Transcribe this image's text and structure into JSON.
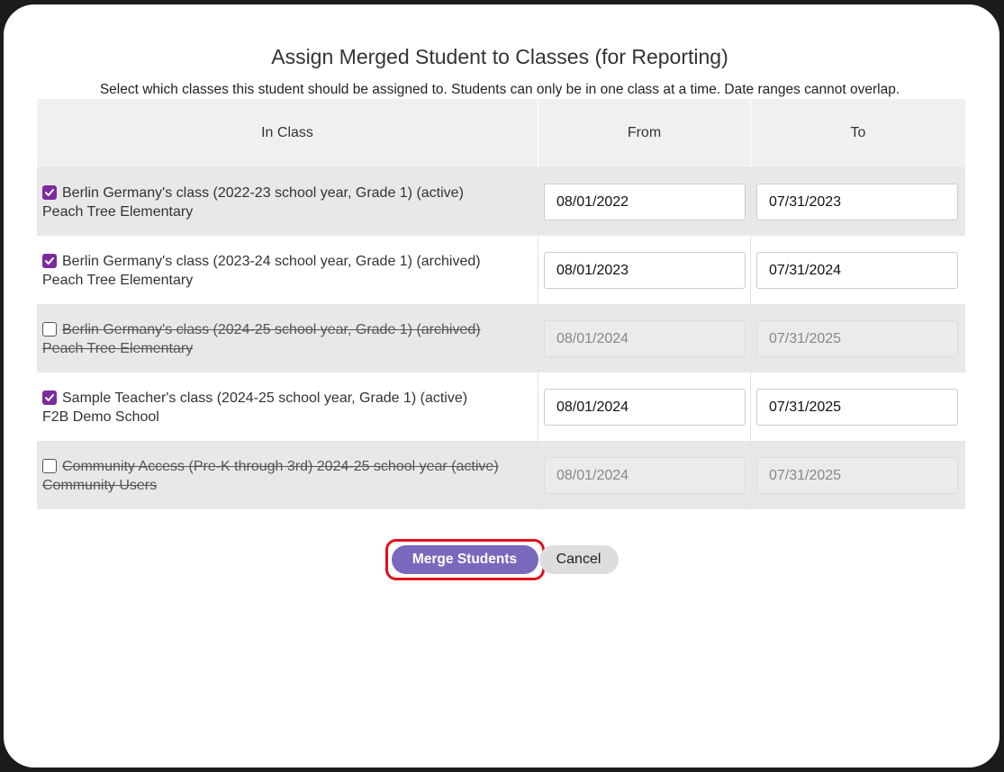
{
  "dialog": {
    "title": "Assign Merged Student to Classes (for Reporting)",
    "instructions": "Select which classes this student should be assigned to. Students can only be in one class at a time. Date ranges cannot overlap."
  },
  "table": {
    "headers": {
      "class": "In Class",
      "from": "From",
      "to": "To"
    },
    "rows": [
      {
        "checked": true,
        "class_name": "Berlin Germany's class (2022-23 school year, Grade 1) (active)",
        "school": "Peach Tree Elementary",
        "from": "08/01/2022",
        "to": "07/31/2023"
      },
      {
        "checked": true,
        "class_name": "Berlin Germany's class (2023-24 school year, Grade 1) (archived)",
        "school": "Peach Tree Elementary",
        "from": "08/01/2023",
        "to": "07/31/2024"
      },
      {
        "checked": false,
        "class_name": "Berlin Germany's class (2024-25 school year, Grade 1) (archived)",
        "school": "Peach Tree Elementary",
        "from": "08/01/2024",
        "to": "07/31/2025"
      },
      {
        "checked": true,
        "class_name": "Sample Teacher's class (2024-25 school year, Grade 1) (active)",
        "school": "F2B Demo School",
        "from": "08/01/2024",
        "to": "07/31/2025"
      },
      {
        "checked": false,
        "class_name": "Community Access (Pre-K through 3rd) 2024-25 school year (active)",
        "school": "Community Users",
        "from": "08/01/2024",
        "to": "07/31/2025"
      }
    ]
  },
  "actions": {
    "merge_label": "Merge Students",
    "cancel_label": "Cancel"
  },
  "colors": {
    "accent": "#7a68bd",
    "checkbox": "#7b2c9c",
    "highlight": "#e0101a"
  }
}
